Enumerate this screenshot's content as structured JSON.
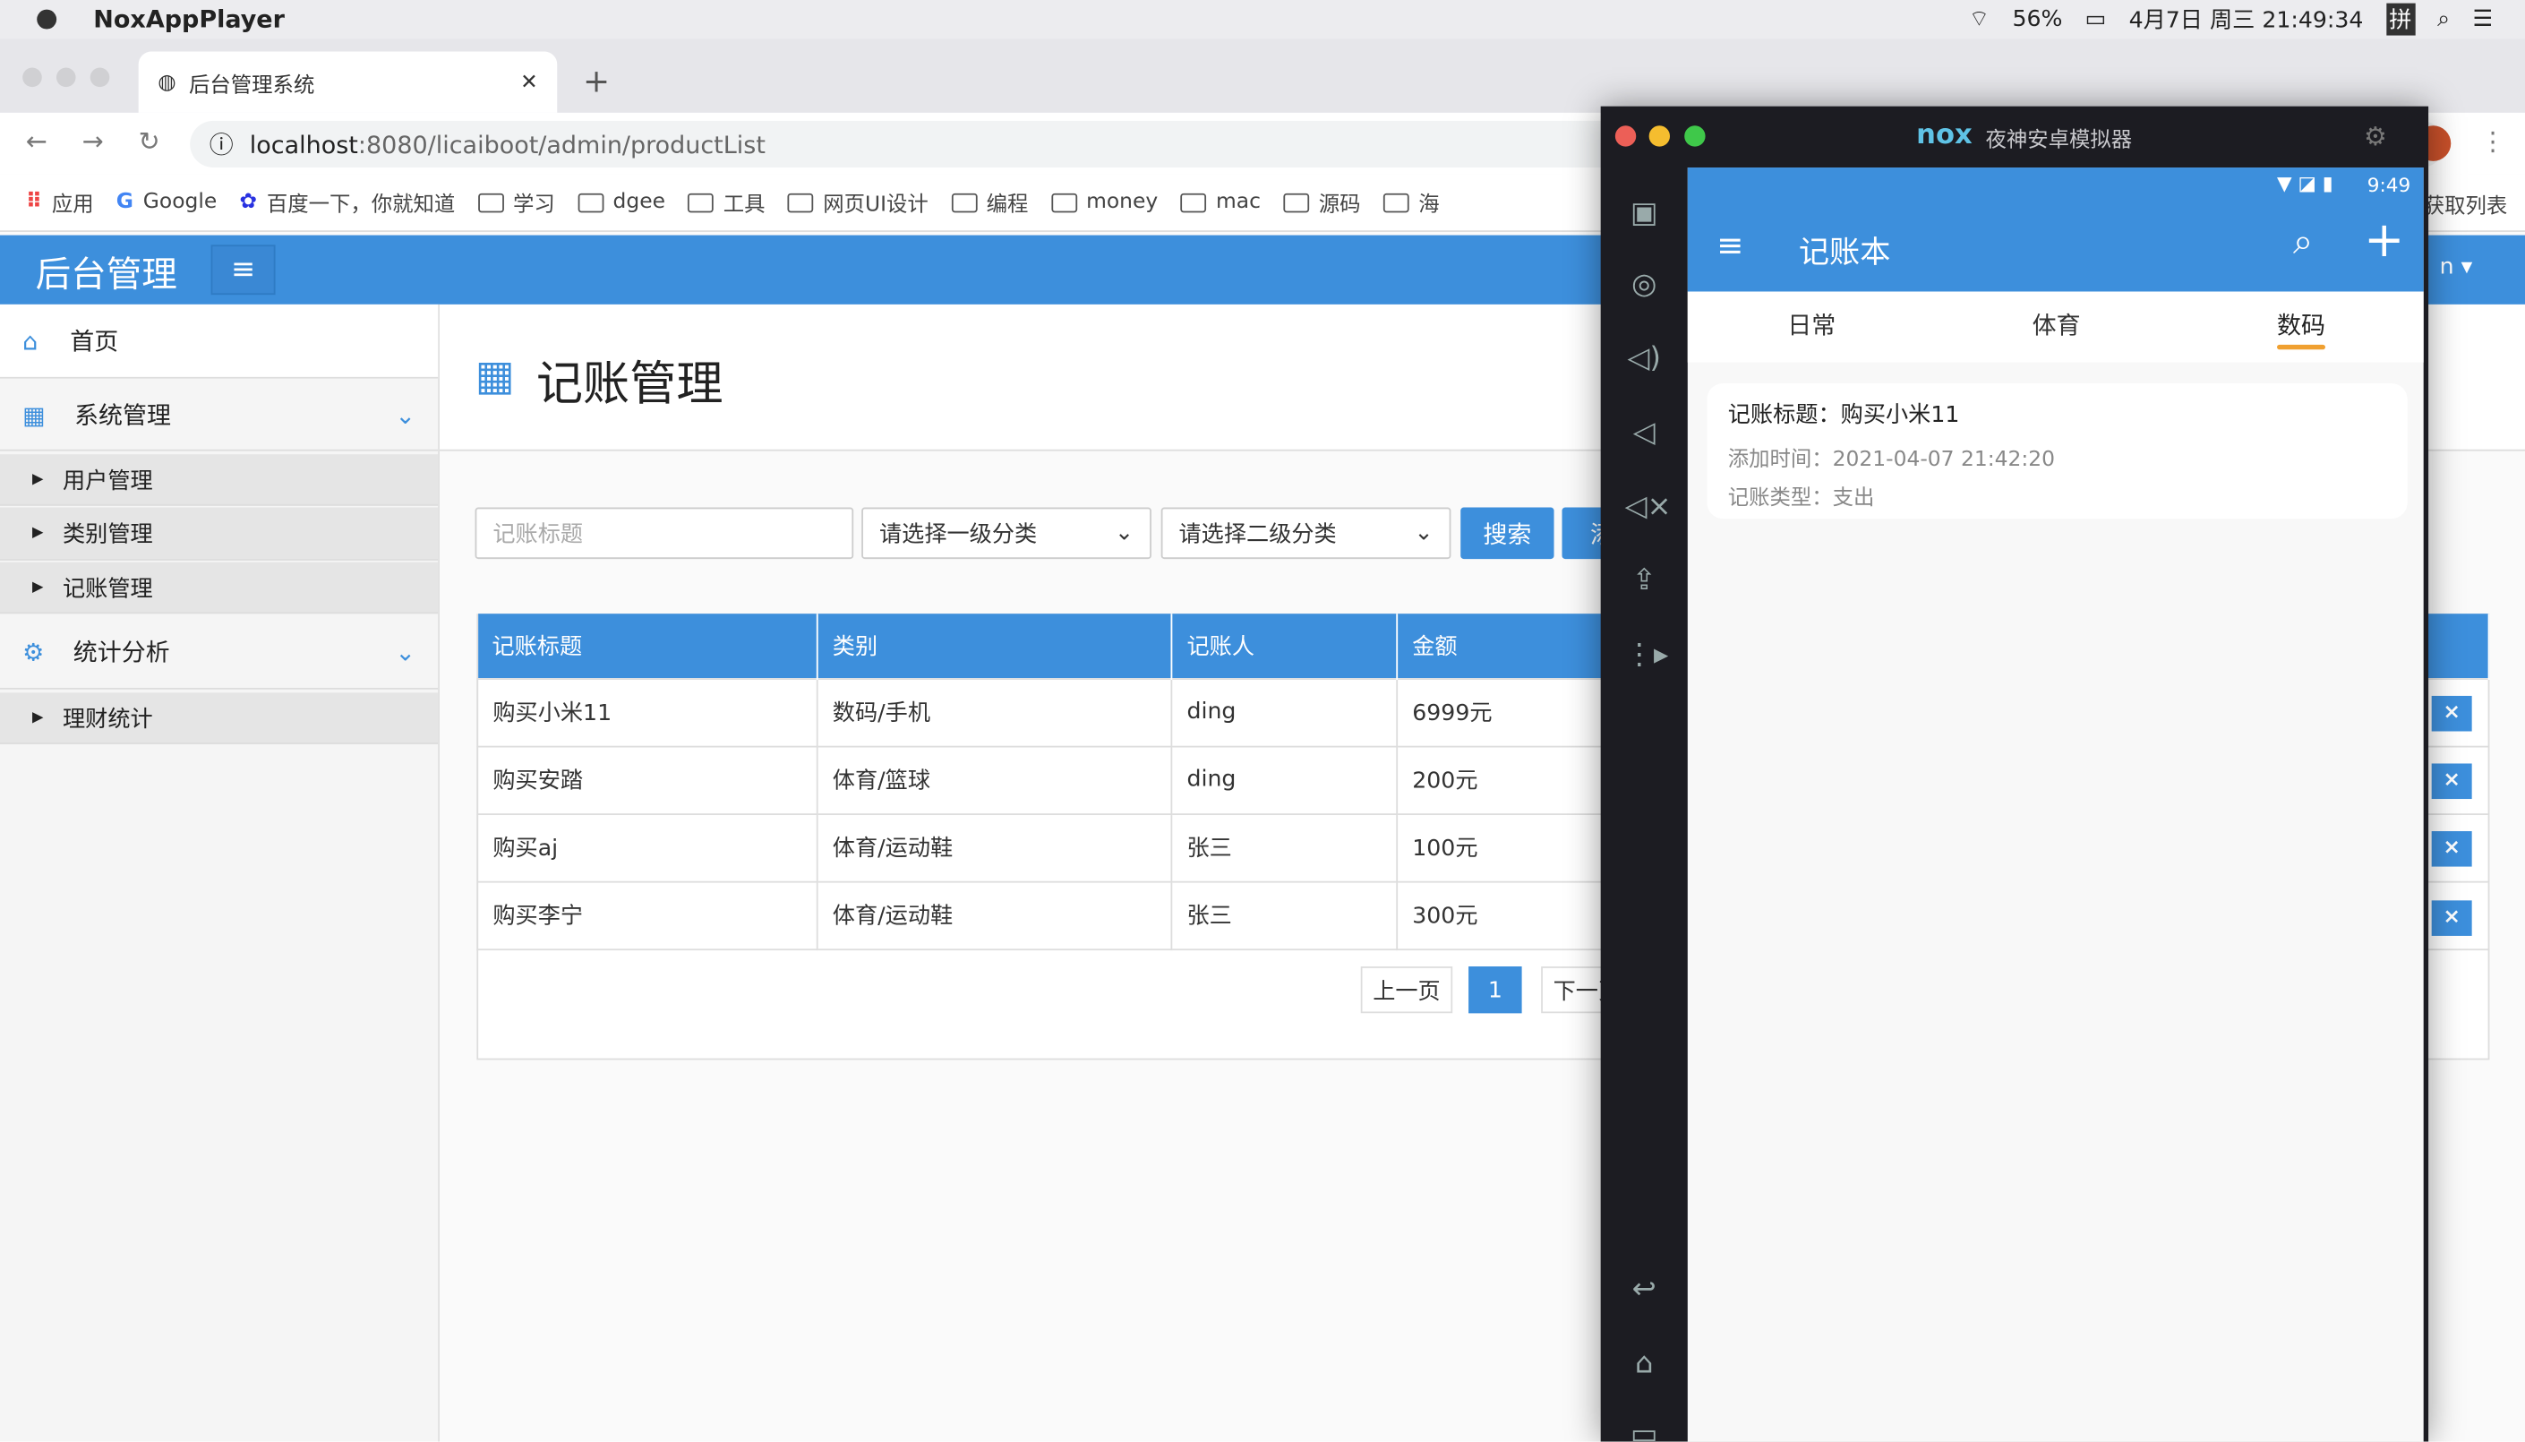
{
  "menubar": {
    "app": "NoxAppPlayer",
    "battery": "56%",
    "datetime": "4月7日 周三 21:49:34",
    "ime": "拼"
  },
  "browser": {
    "tab_title": "后台管理系统",
    "url_host": "localhost",
    "url_path": ":8080/licaiboot/admin/productList",
    "bookmarks": [
      "应用",
      "Google",
      "百度一下，你就知道",
      "学习",
      "dgee",
      "工具",
      "网页UI设计",
      "编程",
      "money",
      "mac",
      "源码",
      "海"
    ],
    "bookmark_right": "获取列表"
  },
  "admin": {
    "brand": "后台管理",
    "user_tail": "n ▾",
    "sidebar": {
      "home": "首页",
      "sys": "系统管理",
      "sys_items": [
        "用户管理",
        "类别管理",
        "记账管理"
      ],
      "stats": "统计分析",
      "stats_items": [
        "理财统计"
      ]
    },
    "page_title": "记账管理",
    "filter": {
      "title_placeholder": "记账标题",
      "cat1": "请选择一级分类",
      "cat2": "请选择二级分类",
      "search": "搜索",
      "add": "添"
    },
    "table": {
      "headers": [
        "记账标题",
        "类别",
        "记账人",
        "金额"
      ],
      "rows": [
        [
          "购买小米11",
          "数码/手机",
          "ding",
          "6999元"
        ],
        [
          "购买安踏",
          "体育/篮球",
          "ding",
          "200元"
        ],
        [
          "购买aj",
          "体育/运动鞋",
          "张三",
          "100元"
        ],
        [
          "购买李宁",
          "体育/运动鞋",
          "张三",
          "300元"
        ]
      ],
      "delete": "×"
    },
    "pagination": {
      "prev": "上一页",
      "current": "1",
      "next": "下一页"
    }
  },
  "nox": {
    "title": "夜神安卓模拟器",
    "logo": "nox",
    "status_time": "9:49",
    "app": {
      "title": "记账本",
      "tabs": [
        "日常",
        "体育",
        "数码"
      ],
      "active_tab": 2,
      "card": {
        "title": "记账标题：购买小米11",
        "time": "添加时间：2021-04-07 21:42:20",
        "type": "记账类型：支出"
      }
    }
  },
  "colors": {
    "primary": "#3d8fdc",
    "tab_indicator": "#f0a030",
    "nox_dark": "#1c1c22"
  }
}
